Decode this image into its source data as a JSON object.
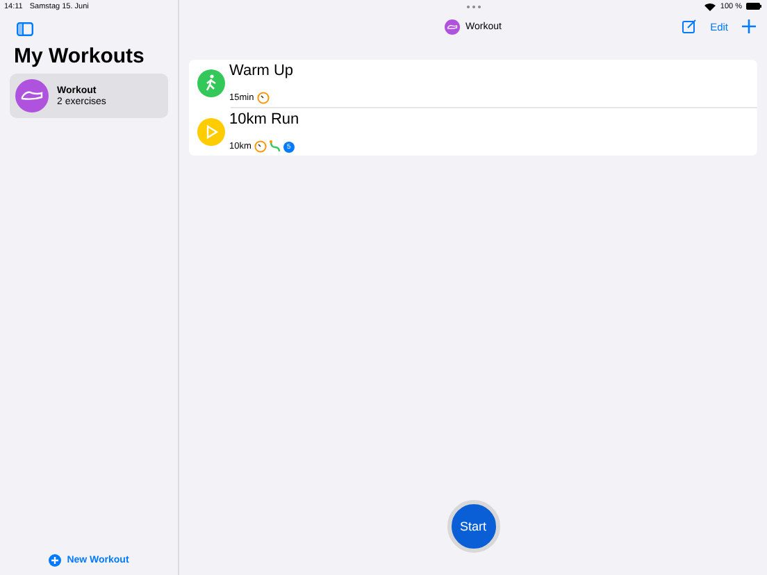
{
  "status_bar": {
    "time": "14:11",
    "date": "Samstag 15. Juni",
    "battery": "100 %"
  },
  "sidebar": {
    "title": "My Workouts",
    "items": [
      {
        "name": "Workout",
        "subtitle": "2 exercises",
        "selected": true
      }
    ],
    "new_button": "New Workout"
  },
  "nav": {
    "title": "Workout",
    "edit": "Edit"
  },
  "exercises": [
    {
      "name": "Warm Up",
      "kind": "walk",
      "detail": "15min",
      "badges": [
        {
          "kind": "timer"
        }
      ]
    },
    {
      "name": "10km Run",
      "kind": "run",
      "detail": "10km",
      "badges": [
        {
          "kind": "timer"
        },
        {
          "kind": "route"
        },
        {
          "kind": "count",
          "text": "5"
        }
      ]
    }
  ],
  "start_button": "Start"
}
